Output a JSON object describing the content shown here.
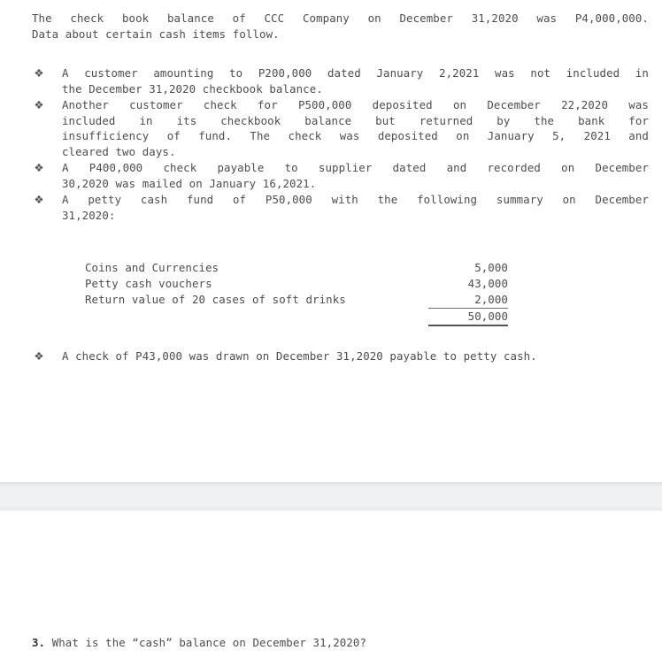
{
  "document": {
    "intro": {
      "line1": "The check book balance of CCC Company on December 31,2020 was P4,000,000.",
      "line2": "Data about certain cash items follow."
    },
    "bullet_glyph": "❖",
    "bullets": [
      {
        "id": "bullet-customer-check-not-included",
        "lines": [
          "A customer amounting to P200,000 dated January 2,2021 was not included in",
          "the December 31,2020 checkbook balance."
        ]
      },
      {
        "id": "bullet-returned-check",
        "lines": [
          "Another customer check for P500,000 deposited on December 22,2020 was",
          "included in its checkbook balance but returned by the bank for",
          "insufficiency of fund. The check was deposited on January 5, 2021 and",
          "cleared two days."
        ]
      },
      {
        "id": "bullet-undelivered-check",
        "lines": [
          "A P400,000 check payable to supplier dated and recorded on December",
          "30,2020 was mailed on January 16,2021."
        ]
      },
      {
        "id": "bullet-petty-cash-fund",
        "lines": [
          "A petty cash fund of P50,000 with the following summary on December",
          "31,2020:"
        ]
      }
    ],
    "summary_table": {
      "rows": [
        {
          "label": "Coins and Currencies",
          "amount": "5,000"
        },
        {
          "label": "Petty cash vouchers",
          "amount": "43,000"
        },
        {
          "label": "Return value of 20 cases of soft drinks",
          "amount": "2,000"
        }
      ],
      "total": {
        "label": "",
        "amount": "50,000"
      }
    },
    "bullets_after_table": [
      {
        "id": "bullet-check-drawn-to-petty-cash",
        "lines": [
          "A check of P43,000 was drawn on December 31,2020 payable to petty cash."
        ]
      }
    ],
    "question": {
      "number": "3.",
      "text": "What is the “cash” balance on December 31,2020?"
    },
    "colors": {
      "text": "#4d4d4d",
      "rule": "#6b6b6b",
      "band_fill": "#f0f1f3",
      "band_edge": "#dcdee1",
      "page_background": "#ffffff"
    }
  }
}
